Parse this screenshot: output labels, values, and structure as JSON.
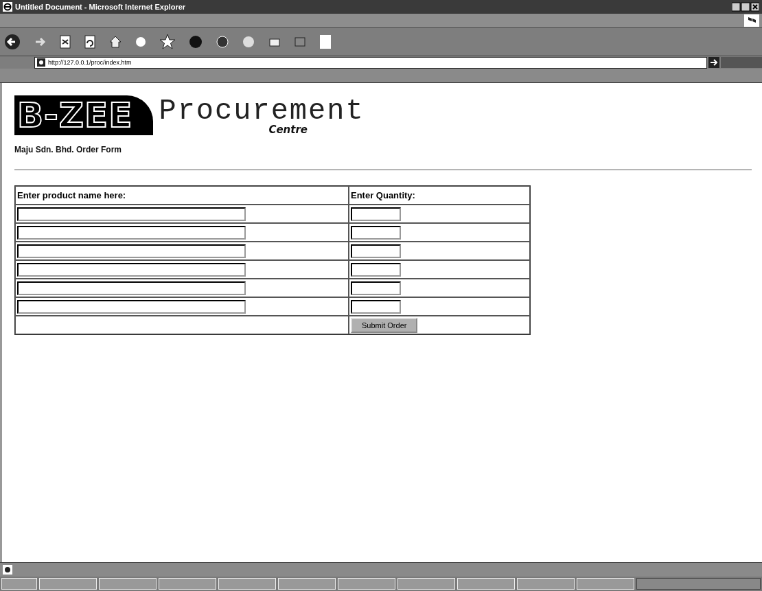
{
  "window": {
    "title": "Untitled Document - Microsoft Internet Explorer"
  },
  "address_bar": {
    "value": "http://127.0.0.1/proc/index.htm"
  },
  "logo": {
    "badge": "B-ZEE",
    "title": "Procurement",
    "subtitle": "Centre"
  },
  "form_title": "Maju Sdn. Bhd. Order Form",
  "table": {
    "columns": [
      "Enter product name here:",
      "Enter Quantity:"
    ],
    "rows": [
      {
        "product": "",
        "quantity": ""
      },
      {
        "product": "",
        "quantity": ""
      },
      {
        "product": "",
        "quantity": ""
      },
      {
        "product": "",
        "quantity": ""
      },
      {
        "product": "",
        "quantity": ""
      },
      {
        "product": "",
        "quantity": ""
      }
    ]
  },
  "submit_button": "Submit Order"
}
